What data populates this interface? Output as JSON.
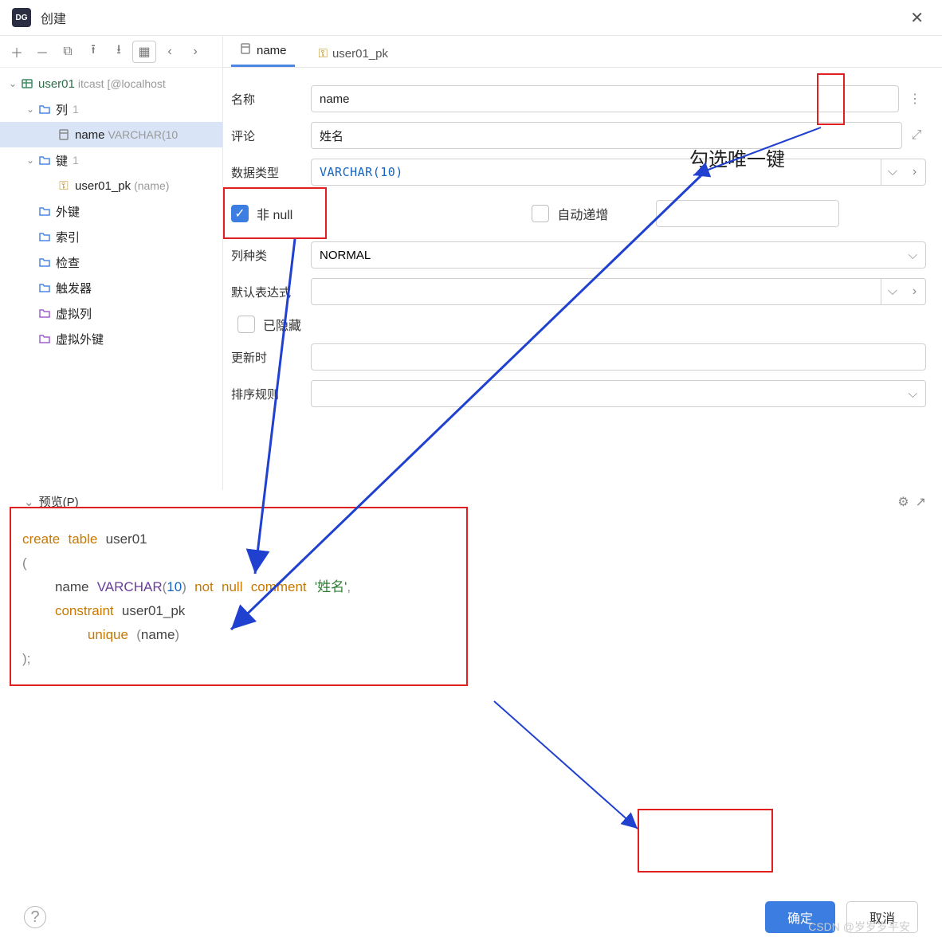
{
  "window": {
    "title": "创建"
  },
  "toolbar_icons": [
    "plus",
    "minus",
    "copy",
    "upload",
    "download",
    "grid",
    "left",
    "right"
  ],
  "tree": {
    "root": {
      "label": "user01",
      "sub": "itcast [@localhost"
    },
    "columns": {
      "label": "列",
      "count": "1"
    },
    "name_col": {
      "label": "name",
      "type": "VARCHAR(10"
    },
    "keys": {
      "label": "键",
      "count": "1"
    },
    "pk": {
      "label": "user01_pk",
      "sub": "(name)"
    },
    "fk": "外键",
    "idx": "索引",
    "chk": "检查",
    "trg": "触发器",
    "vcol": "虚拟列",
    "vfk": "虚拟外键"
  },
  "tabs": {
    "name": "name",
    "pk": "user01_pk"
  },
  "form": {
    "name_label": "名称",
    "name_value": "name",
    "comment_label": "评论",
    "comment_value": "姓名",
    "datatype_label": "数据类型",
    "datatype_value": "VARCHAR(10)",
    "notnull_label": "非 null",
    "notnull_checked": true,
    "autoinc_label": "自动递增",
    "autoinc_checked": false,
    "colkind_label": "列种类",
    "colkind_value": "NORMAL",
    "default_label": "默认表达式",
    "hidden_label": "已隐藏",
    "update_label": "更新时",
    "collation_label": "排序规则"
  },
  "preview": {
    "header": "预览(P)",
    "sql": {
      "kw_create": "create",
      "kw_table": "table",
      "tbl": "user01",
      "col": "name",
      "coltype": "VARCHAR",
      "len": "10",
      "kw_not": "not",
      "kw_null": "null",
      "kw_comment": "comment",
      "comment_val": "'姓名'",
      "kw_constraint": "constraint",
      "pk_name": "user01_pk",
      "kw_unique": "unique",
      "uq_col": "name"
    }
  },
  "annotation": "勾选唯一键",
  "buttons": {
    "ok": "确定",
    "cancel": "取消"
  },
  "watermark": "CSDN @岁岁岁平安"
}
